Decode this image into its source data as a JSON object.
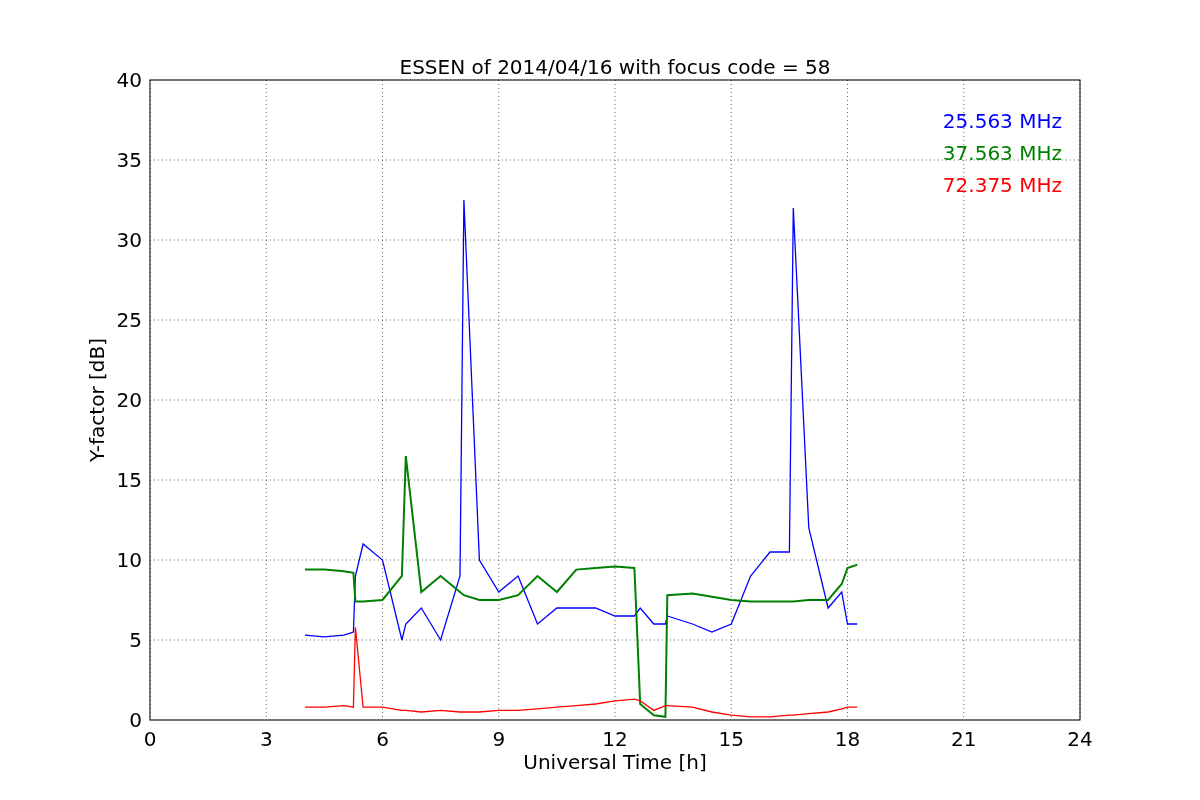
{
  "figure": {
    "chart_data": {
      "type": "line",
      "title": "ESSEN of 2014/04/16 with focus code = 58",
      "xlabel": "Universal Time [h]",
      "ylabel": "Y-factor [dB]",
      "x": [
        4,
        4.5,
        5,
        5.25,
        5.3,
        5.5,
        6,
        6.5,
        6.6,
        7,
        7.5,
        8,
        8.1,
        8.5,
        9,
        9.5,
        10,
        10.5,
        11,
        11.5,
        12,
        12.5,
        12.65,
        13,
        13.3,
        13.35,
        14,
        14.5,
        15,
        15.5,
        16,
        16.5,
        16.6,
        17,
        17.5,
        17.85,
        18,
        18.25
      ],
      "series": [
        {
          "name": "25.563 MHz",
          "color": "#0000ff",
          "values": [
            5.3,
            5.2,
            5.3,
            5.5,
            9,
            11,
            10,
            5,
            6,
            7,
            5,
            9,
            32.5,
            10,
            8,
            9,
            6,
            7,
            7,
            7,
            6.5,
            6.5,
            7,
            6,
            6,
            6.5,
            6,
            5.5,
            6,
            9,
            10.5,
            10.5,
            32,
            12,
            7,
            8,
            6,
            6
          ]
        },
        {
          "name": "37.563 MHz",
          "color": "#008000",
          "values": [
            9.4,
            9.4,
            9.3,
            9.2,
            7.4,
            7.4,
            7.5,
            9,
            16.5,
            8,
            9,
            8,
            7.8,
            7.5,
            7.5,
            7.8,
            9,
            8,
            9.4,
            9.5,
            9.6,
            9.5,
            1,
            0.3,
            0.2,
            7.8,
            7.9,
            7.7,
            7.5,
            7.4,
            7.4,
            7.4,
            7.4,
            7.5,
            7.5,
            8.5,
            9.5,
            9.7
          ]
        },
        {
          "name": "72.375 MHz",
          "color": "#ff0000",
          "values": [
            0.8,
            0.8,
            0.9,
            0.8,
            5.8,
            0.8,
            0.8,
            0.6,
            0.6,
            0.5,
            0.6,
            0.5,
            0.5,
            0.5,
            0.6,
            0.6,
            0.7,
            0.8,
            0.9,
            1,
            1.2,
            1.3,
            1.2,
            0.6,
            0.9,
            0.9,
            0.8,
            0.5,
            0.3,
            0.2,
            0.2,
            0.3,
            0.3,
            0.4,
            0.5,
            0.7,
            0.8,
            0.8
          ]
        }
      ],
      "grid": true,
      "xlim": [
        0,
        24
      ],
      "ylim": [
        0,
        40
      ],
      "xticks": [
        0,
        3,
        6,
        9,
        12,
        15,
        18,
        21,
        24
      ],
      "yticks": [
        0,
        5,
        10,
        15,
        20,
        25,
        30,
        35,
        40
      ]
    }
  }
}
